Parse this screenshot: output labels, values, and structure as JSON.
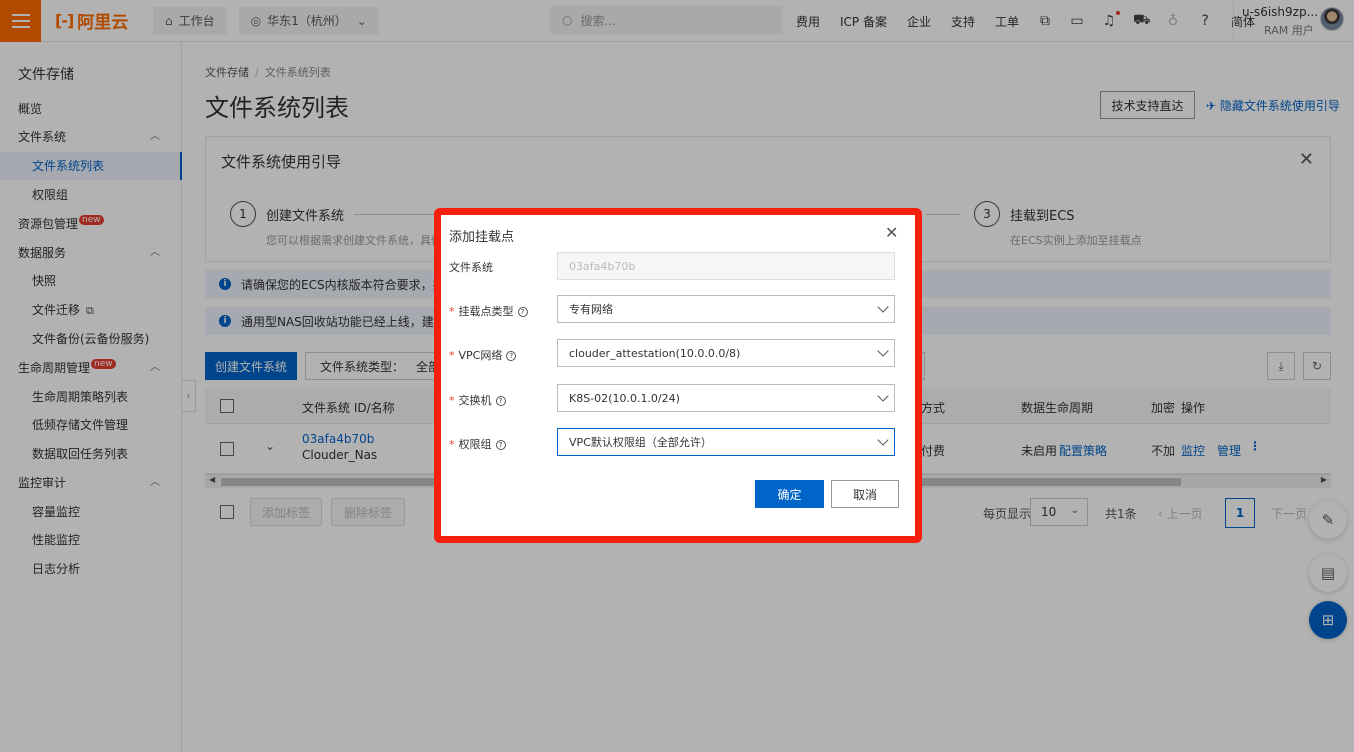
{
  "topbar": {
    "logo_text": "阿里云",
    "workbench": "工作台",
    "region": "华东1（杭州）",
    "search_placeholder": "搜索...",
    "nav": [
      "费用",
      "ICP 备案",
      "企业",
      "支持",
      "工单"
    ],
    "lang": "简体",
    "user_name": "u-s6ish9zp...",
    "user_role": "RAM 用户",
    "icons": [
      "code-icon",
      "terminal-icon",
      "bell-icon",
      "cart-icon",
      "lightbulb-icon",
      "help-icon"
    ]
  },
  "sidebar": {
    "title": "文件存储",
    "items": [
      {
        "label": "概览"
      },
      {
        "label": "文件系统"
      },
      {
        "label": "文件系统列表"
      },
      {
        "label": "权限组"
      },
      {
        "label": "资源包管理",
        "badge": "new"
      },
      {
        "label": "数据服务"
      },
      {
        "label": "快照"
      },
      {
        "label": "文件迁移"
      },
      {
        "label": "文件备份(云备份服务)"
      },
      {
        "label": "生命周期管理",
        "badge": "new"
      },
      {
        "label": "生命周期策略列表"
      },
      {
        "label": "低频存储文件管理"
      },
      {
        "label": "数据取回任务列表"
      },
      {
        "label": "监控审计"
      },
      {
        "label": "容量监控"
      },
      {
        "label": "性能监控"
      },
      {
        "label": "日志分析"
      }
    ]
  },
  "main": {
    "breadcrumb": [
      "文件存储",
      "文件系统列表"
    ],
    "title": "文件系统列表",
    "tech_support": "技术支持直达",
    "hide_guide": "隐藏文件系统使用引导",
    "guide": {
      "title": "文件系统使用引导",
      "steps": [
        {
          "num": "1",
          "name": "创建文件系统",
          "desc": "您可以根据需求创建文件系统，具体"
        },
        {
          "num": "3",
          "name": "挂载到ECS",
          "desc": "在ECS实例上添加至挂载点"
        }
      ]
    },
    "notices": [
      "请确保您的ECS内核版本符合要求，并且",
      "通用型NAS回收站功能已经上线，建议您"
    ],
    "create_button": "创建文件系统",
    "type_filter_label": "文件系统类型：",
    "type_filter_value": "全部",
    "table": {
      "headers": {
        "id": "文件系统 ID/名称",
        "billing": "方式",
        "lifecycle": "数据生命周期",
        "encrypt": "加密",
        "ops": "操作"
      },
      "row": {
        "id": "03afa4b70b",
        "name": "Clouder_Nas",
        "billing": "付费",
        "lifecycle": "未启用",
        "lifecycle_link": "配置策略",
        "encrypt": "不加",
        "monitor": "监控",
        "manage": "管理"
      }
    },
    "footer": {
      "add_tag": "添加标签",
      "remove_tag": "删除标签",
      "per_page_label": "每页显示",
      "per_page": "10",
      "total": "共1条",
      "prev": "上一页",
      "page": "1",
      "next": "下一页"
    }
  },
  "dialog": {
    "title": "添加挂载点",
    "fields": [
      {
        "label": "文件系统",
        "value": "03afa4b70b",
        "required": false
      },
      {
        "label": "挂载点类型",
        "value": "专有网络",
        "required": true
      },
      {
        "label": "VPC网络",
        "value": "clouder_attestation(10.0.0.0/8)",
        "required": true
      },
      {
        "label": "交换机",
        "value": "K8S-02(10.0.1.0/24)",
        "required": true
      },
      {
        "label": "权限组",
        "value": "VPC默认权限组（全部允许）",
        "required": true
      }
    ],
    "ok": "确定",
    "cancel": "取消"
  },
  "colors": {
    "brand": "#ff6a00",
    "primary": "#0064c8",
    "highlight": "#f5200e"
  }
}
